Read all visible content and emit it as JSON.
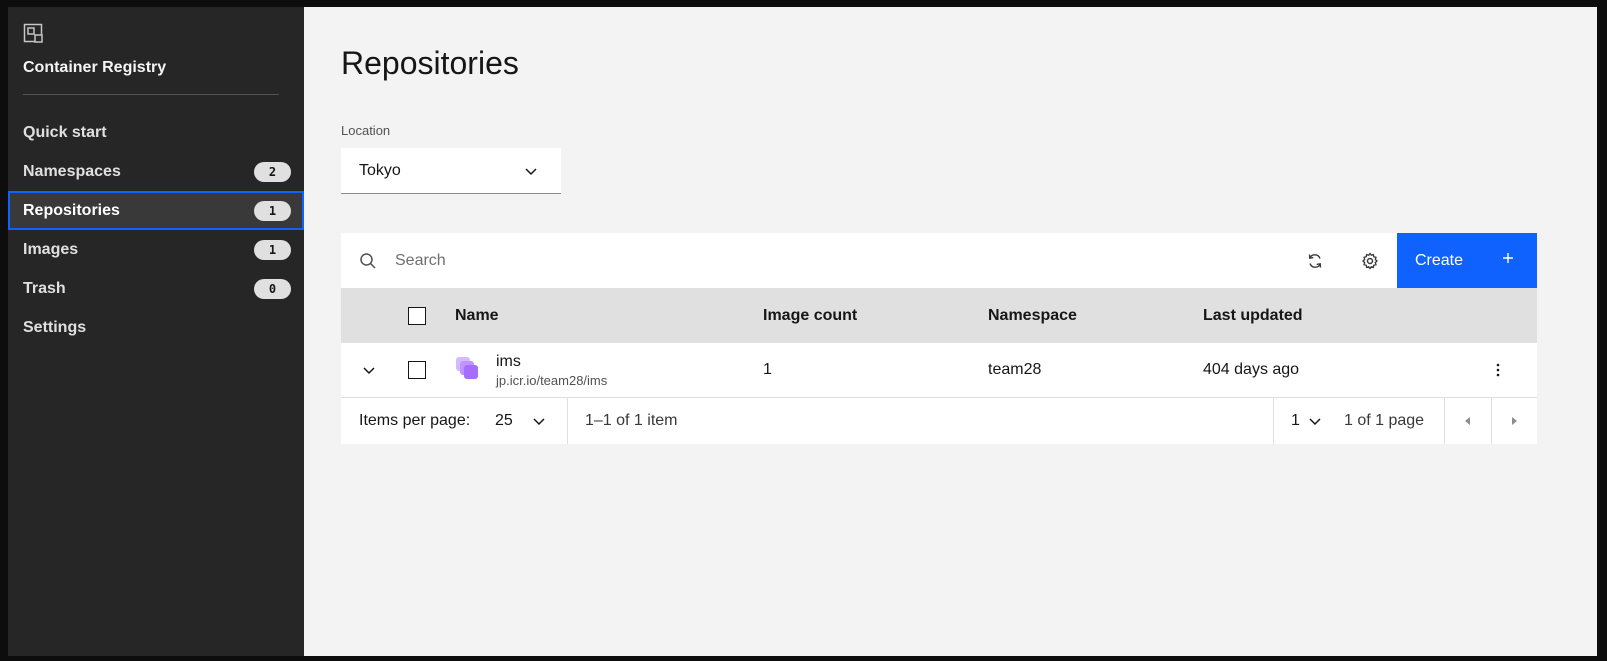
{
  "sidebar": {
    "title": "Container Registry",
    "items": [
      {
        "label": "Quick start",
        "badge": null
      },
      {
        "label": "Namespaces",
        "badge": "2"
      },
      {
        "label": "Repositories",
        "badge": "1",
        "active": true
      },
      {
        "label": "Images",
        "badge": "1"
      },
      {
        "label": "Trash",
        "badge": "0"
      },
      {
        "label": "Settings",
        "badge": null
      }
    ]
  },
  "main": {
    "title": "Repositories",
    "location": {
      "label": "Location",
      "value": "Tokyo"
    },
    "toolbar": {
      "search_placeholder": "Search",
      "create_label": "Create"
    },
    "table": {
      "headers": {
        "name": "Name",
        "image_count": "Image count",
        "namespace": "Namespace",
        "last_updated": "Last updated"
      },
      "rows": [
        {
          "name": "ims",
          "path": "jp.icr.io/team28/ims",
          "image_count": "1",
          "namespace": "team28",
          "last_updated": "404 days ago"
        }
      ]
    },
    "pagination": {
      "items_per_page_label": "Items per page:",
      "page_size": "25",
      "range": "1–1 of 1 item",
      "current_page": "1",
      "total_pages": "1 of 1 page"
    }
  },
  "colors": {
    "accent": "#0f62fe",
    "sidebar_bg": "#262626",
    "repo_icon": "#a56eff"
  }
}
